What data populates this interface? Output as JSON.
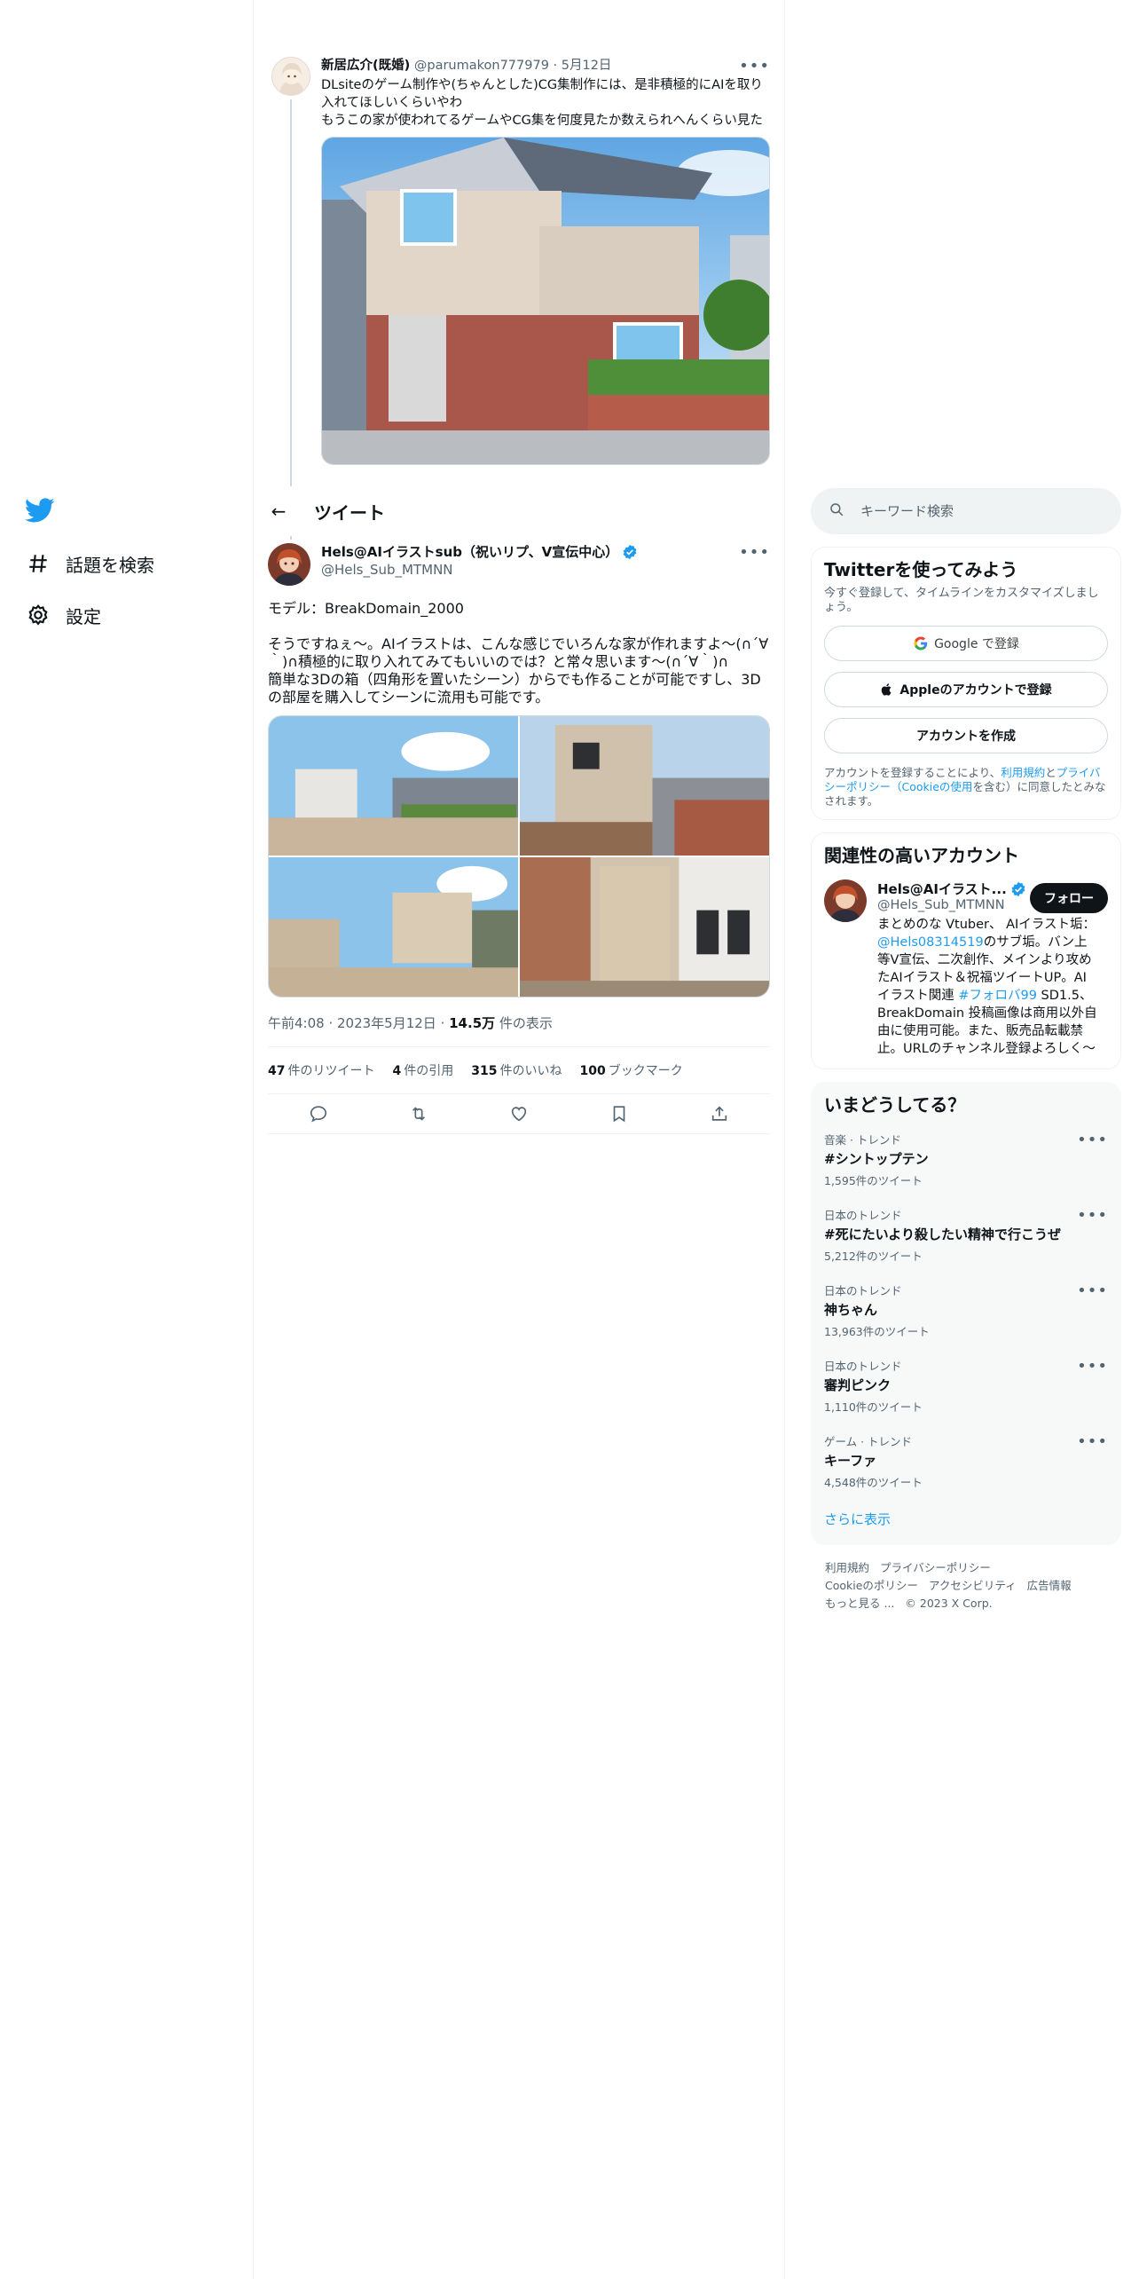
{
  "nav": {
    "items": [
      {
        "label": "話題を検索",
        "icon": "hashtag-icon"
      },
      {
        "label": "設定",
        "icon": "gear-icon"
      }
    ]
  },
  "quoted": {
    "name": "新居広介(既婚)",
    "handle": "@parumakon777979",
    "sep": "·",
    "date": "5月12日",
    "text": "DLsiteのゲーム制作や(ちゃんとした)CG集制作には、是非積極的にAIを取り入れてほしいくらいやわ\nもうこの家が使われてるゲームやCG集を何度見たか数えられへんくらい見た"
  },
  "header": {
    "title": "ツイート"
  },
  "tweet": {
    "name": "Hels@AIイラストsub（祝いリプ、V宣伝中心）",
    "handle": "@Hels_Sub_MTMNN",
    "text": "モデル：BreakDomain_2000\n\nそうですねぇ～。AIイラストは、こんな感じでいろんな家が作れますよ～(∩´∀｀)∩積極的に取り入れてみてもいいのでは？と常々思います～(∩´∀｀)∩\n簡単な3Dの箱（四角形を置いたシーン）からでも作ることが可能ですし、3Dの部屋を購入してシーンに流用も可能です。",
    "time": "午前4:08",
    "date": "2023年5月12日",
    "views": "14.5万",
    "views_label": "件の表示",
    "retweets": "47",
    "retweets_label": "件のリツイート",
    "quotes": "4",
    "quotes_label": "件の引用",
    "likes": "315",
    "likes_label": "件のいいね",
    "bookmarks": "100",
    "bookmarks_label": "ブックマーク"
  },
  "search": {
    "placeholder": "キーワード検索"
  },
  "signup": {
    "title": "Twitterを使ってみよう",
    "subtitle": "今すぐ登録して、タイムラインをカスタマイズしましょう。",
    "google": "Google で登録",
    "apple": "Appleのアカウントで登録",
    "create": "アカウントを作成",
    "note_prefix": "アカウントを登録することにより、",
    "terms": "利用規約",
    "and": "と",
    "privacy": "プライバシーポリシー（Cookieの使用",
    "note_suffix": "を含む）に同意したとみなされます。"
  },
  "related": {
    "title": "関連性の高いアカウント",
    "name": "Hels@AIイラスト...",
    "handle": "@Hels_Sub_MTMNN",
    "follow": "フォロー",
    "bio_1": "まとめのな Vtuber、 AIイラスト垢：",
    "bio_mention": "@Hels08314519",
    "bio_2": "のサブ垢。バン上等V宣伝、二次創作、メインより攻めたAIイラスト＆祝福ツイートUP。AIイラスト関連 ",
    "bio_tag": "#フォロバ99",
    "bio_3": " SD1.5、BreakDomain 投稿画像は商用以外自由に使用可能。また、販売品転載禁止。URLのチャンネル登録よろしく～"
  },
  "trends": {
    "title": "いまどうしてる？",
    "items": [
      {
        "category": "音楽 · トレンド",
        "name": "#シントップテン",
        "count": "1,595件のツイート"
      },
      {
        "category": "日本のトレンド",
        "name": "#死にたいより殺したい精神で行こうぜ",
        "count": "5,212件のツイート"
      },
      {
        "category": "日本のトレンド",
        "name": "神ちゃん",
        "count": "13,963件のツイート"
      },
      {
        "category": "日本のトレンド",
        "name": "審判ピンク",
        "count": "1,110件のツイート"
      },
      {
        "category": "ゲーム · トレンド",
        "name": "キーファ",
        "count": "4,548件のツイート"
      }
    ],
    "show_more": "さらに表示"
  },
  "footer": {
    "links": [
      "利用規約",
      "プライバシーポリシー",
      "Cookieのポリシー",
      "アクセシビリティ",
      "広告情報",
      "もっと見る ..."
    ],
    "copyright": "© 2023 X Corp."
  },
  "colors": {
    "accent": "#1d9bf0",
    "text": "#0f1419",
    "muted": "#536471"
  }
}
